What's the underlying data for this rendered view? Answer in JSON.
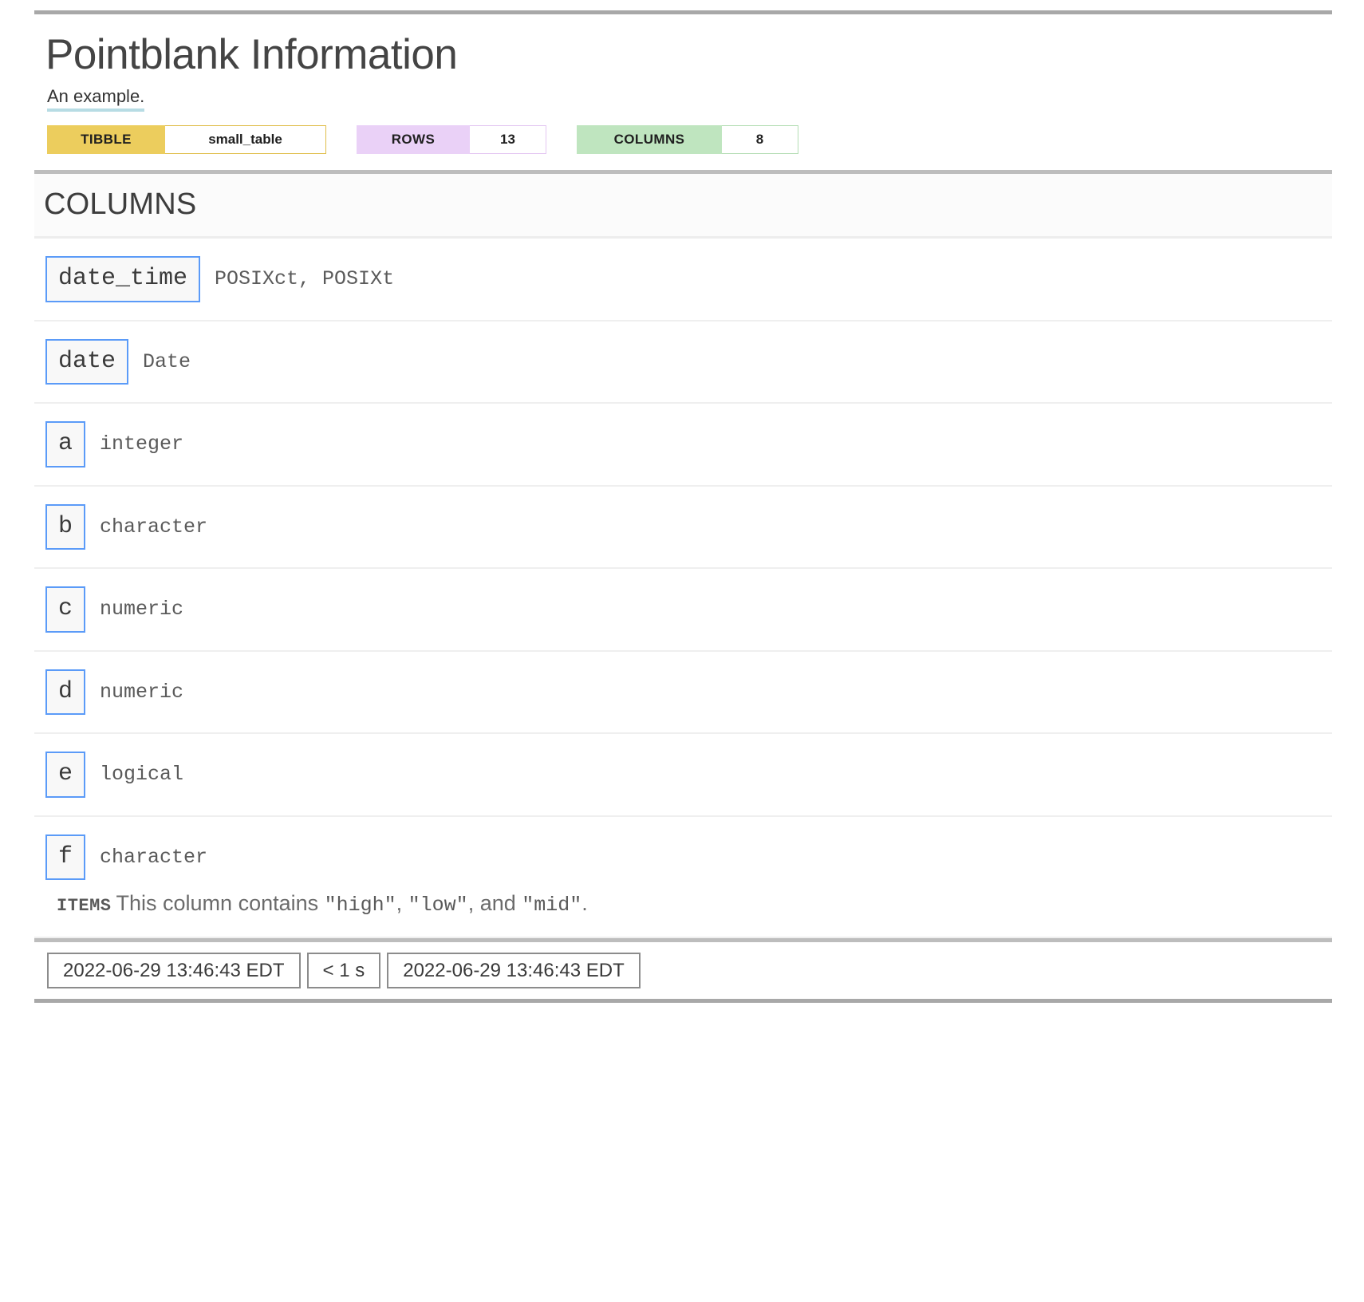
{
  "report": {
    "title": "Pointblank Information",
    "subtitle": "An example.",
    "badges": [
      {
        "key": "TIBBLE",
        "value": "small_table"
      },
      {
        "key": "ROWS",
        "value": "13"
      },
      {
        "key": "COLUMNS",
        "value": "8"
      }
    ],
    "section_title": "COLUMNS",
    "columns": [
      {
        "name": "date_time",
        "type": "POSIXct, POSIXt"
      },
      {
        "name": "date",
        "type": "Date"
      },
      {
        "name": "a",
        "type": "integer"
      },
      {
        "name": "b",
        "type": "character"
      },
      {
        "name": "c",
        "type": "numeric"
      },
      {
        "name": "d",
        "type": "numeric"
      },
      {
        "name": "e",
        "type": "logical"
      },
      {
        "name": "f",
        "type": "character"
      }
    ],
    "items_note": {
      "label": "ITEMS",
      "prefix": "This column contains ",
      "value_1": "\"high\"",
      "sep_1": ", ",
      "value_2": "\"low\"",
      "sep_2": ", and ",
      "value_3": "\"mid\"",
      "suffix": "."
    },
    "footer": {
      "start_time": "2022-06-29 13:46:43 EDT",
      "duration": "< 1 s",
      "end_time": "2022-06-29 13:46:43 EDT"
    },
    "colors": {
      "tibble_key_bg": "#ECCD5D",
      "rows_key_bg": "#EAD1F7",
      "columns_key_bg": "#BFE5BF",
      "chip_border": "#5B9BF8",
      "subtitle_underline": "#B7DCE4",
      "frame_rule": "#A8A8A8"
    }
  }
}
